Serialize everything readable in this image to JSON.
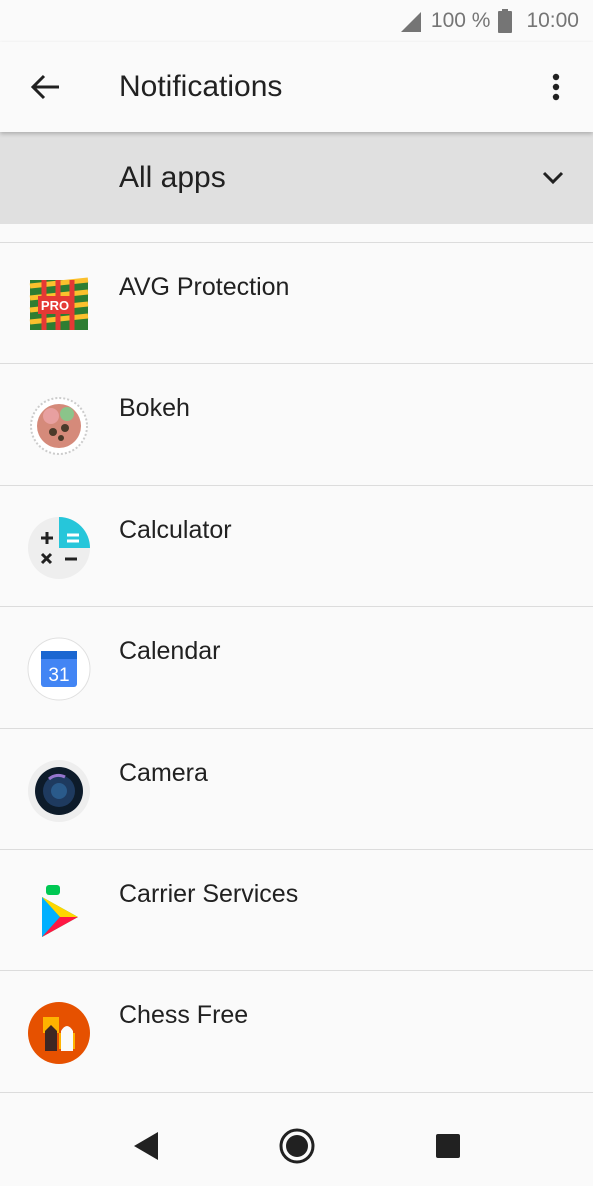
{
  "status": {
    "battery": "100 %",
    "time": "10:00"
  },
  "toolbar": {
    "title": "Notifications"
  },
  "filter": {
    "selected": "All apps"
  },
  "apps": [
    {
      "name": "AVG Protection",
      "icon": "avg-protection-icon"
    },
    {
      "name": "Bokeh",
      "icon": "bokeh-icon"
    },
    {
      "name": "Calculator",
      "icon": "calculator-icon"
    },
    {
      "name": "Calendar",
      "icon": "calendar-icon",
      "icon_text": "31"
    },
    {
      "name": "Camera",
      "icon": "camera-icon"
    },
    {
      "name": "Carrier Services",
      "icon": "carrier-services-icon"
    },
    {
      "name": "Chess Free",
      "icon": "chess-free-icon"
    }
  ],
  "colors": {
    "background": "#fafafa",
    "filter_bg": "#e0e0e0",
    "text": "#212121",
    "divider": "#dcdcdc",
    "status": "#757575"
  }
}
